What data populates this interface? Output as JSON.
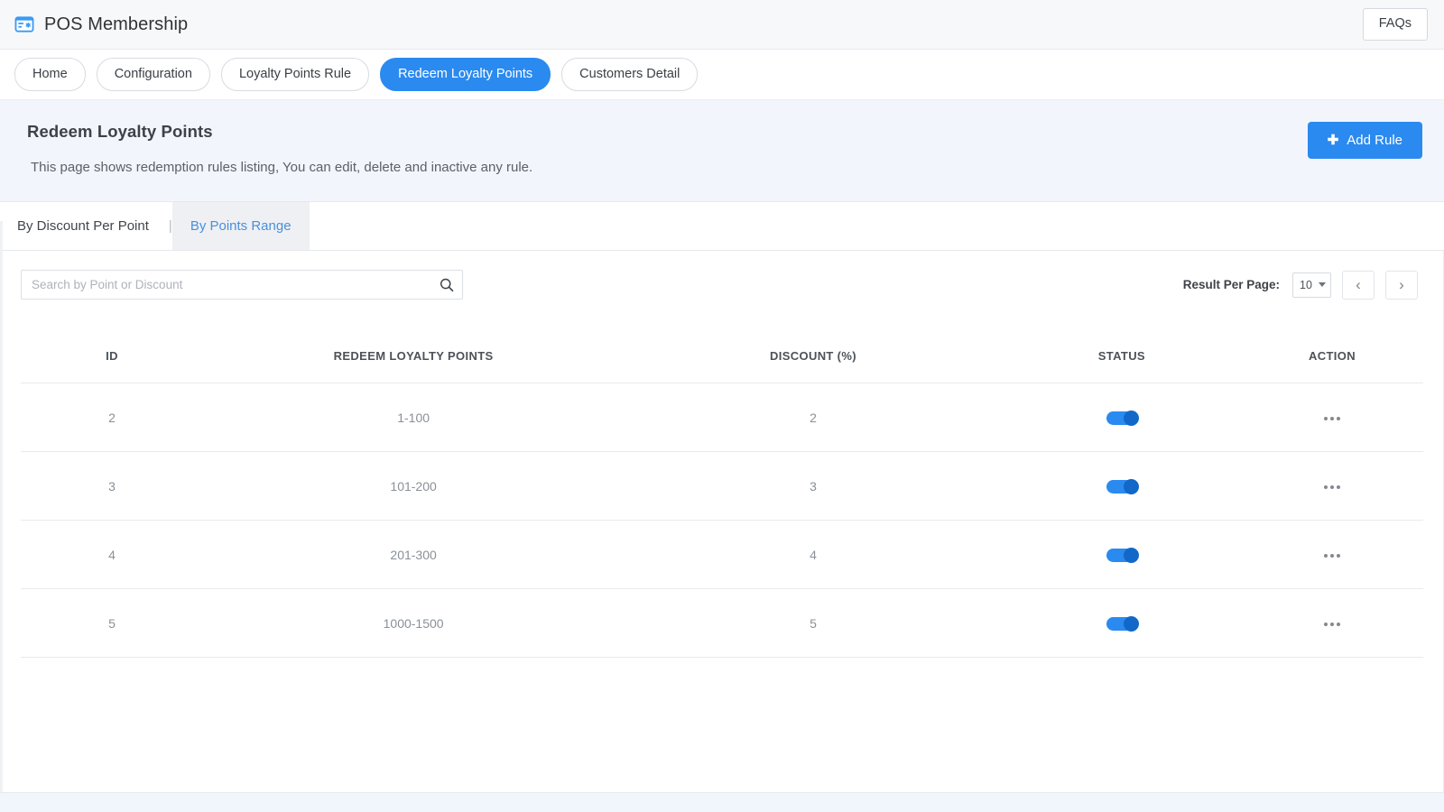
{
  "topbar": {
    "brand_icon": "id-card-icon",
    "brand_title": "POS Membership",
    "faqs_label": "FAQs"
  },
  "nav": {
    "items": [
      {
        "label": "Home",
        "active": false
      },
      {
        "label": "Configuration",
        "active": false
      },
      {
        "label": "Loyalty Points Rule",
        "active": false
      },
      {
        "label": "Redeem Loyalty Points",
        "active": true
      },
      {
        "label": "Customers Detail",
        "active": false
      }
    ],
    "active_color": "#2a8af0"
  },
  "page_header": {
    "title": "Redeem Loyalty Points",
    "description": "This page shows redemption rules listing, You can edit, delete and inactive any rule.",
    "add_button_label": "Add Rule",
    "add_button_icon": "plus-icon",
    "add_button_color": "#2a8af0",
    "background": "#f2f6fc"
  },
  "subtabs": {
    "first_label": "By Discount Per Point",
    "separator": "|",
    "second_label": "By Points Range",
    "active_index": 1,
    "active_color": "#4a90d9"
  },
  "toolbar": {
    "search": {
      "placeholder": "Search by Point or Discount",
      "value": "",
      "icon": "search-icon"
    },
    "result_per_page_label": "Result Per Page:",
    "result_per_page_value": "10",
    "prev_label": "‹",
    "next_label": "›"
  },
  "table": {
    "columns": [
      "ID",
      "REDEEM LOYALTY POINTS",
      "DISCOUNT (%)",
      "STATUS",
      "ACTION"
    ],
    "rows": [
      {
        "id": "2",
        "points": "1-100",
        "discount": "2",
        "status_on": true,
        "action_icon": "more-dots-icon"
      },
      {
        "id": "3",
        "points": "101-200",
        "discount": "3",
        "status_on": true,
        "action_icon": "more-dots-icon"
      },
      {
        "id": "4",
        "points": "201-300",
        "discount": "4",
        "status_on": true,
        "action_icon": "more-dots-icon"
      },
      {
        "id": "5",
        "points": "1000-1500",
        "discount": "5",
        "status_on": true,
        "action_icon": "more-dots-icon"
      }
    ]
  }
}
